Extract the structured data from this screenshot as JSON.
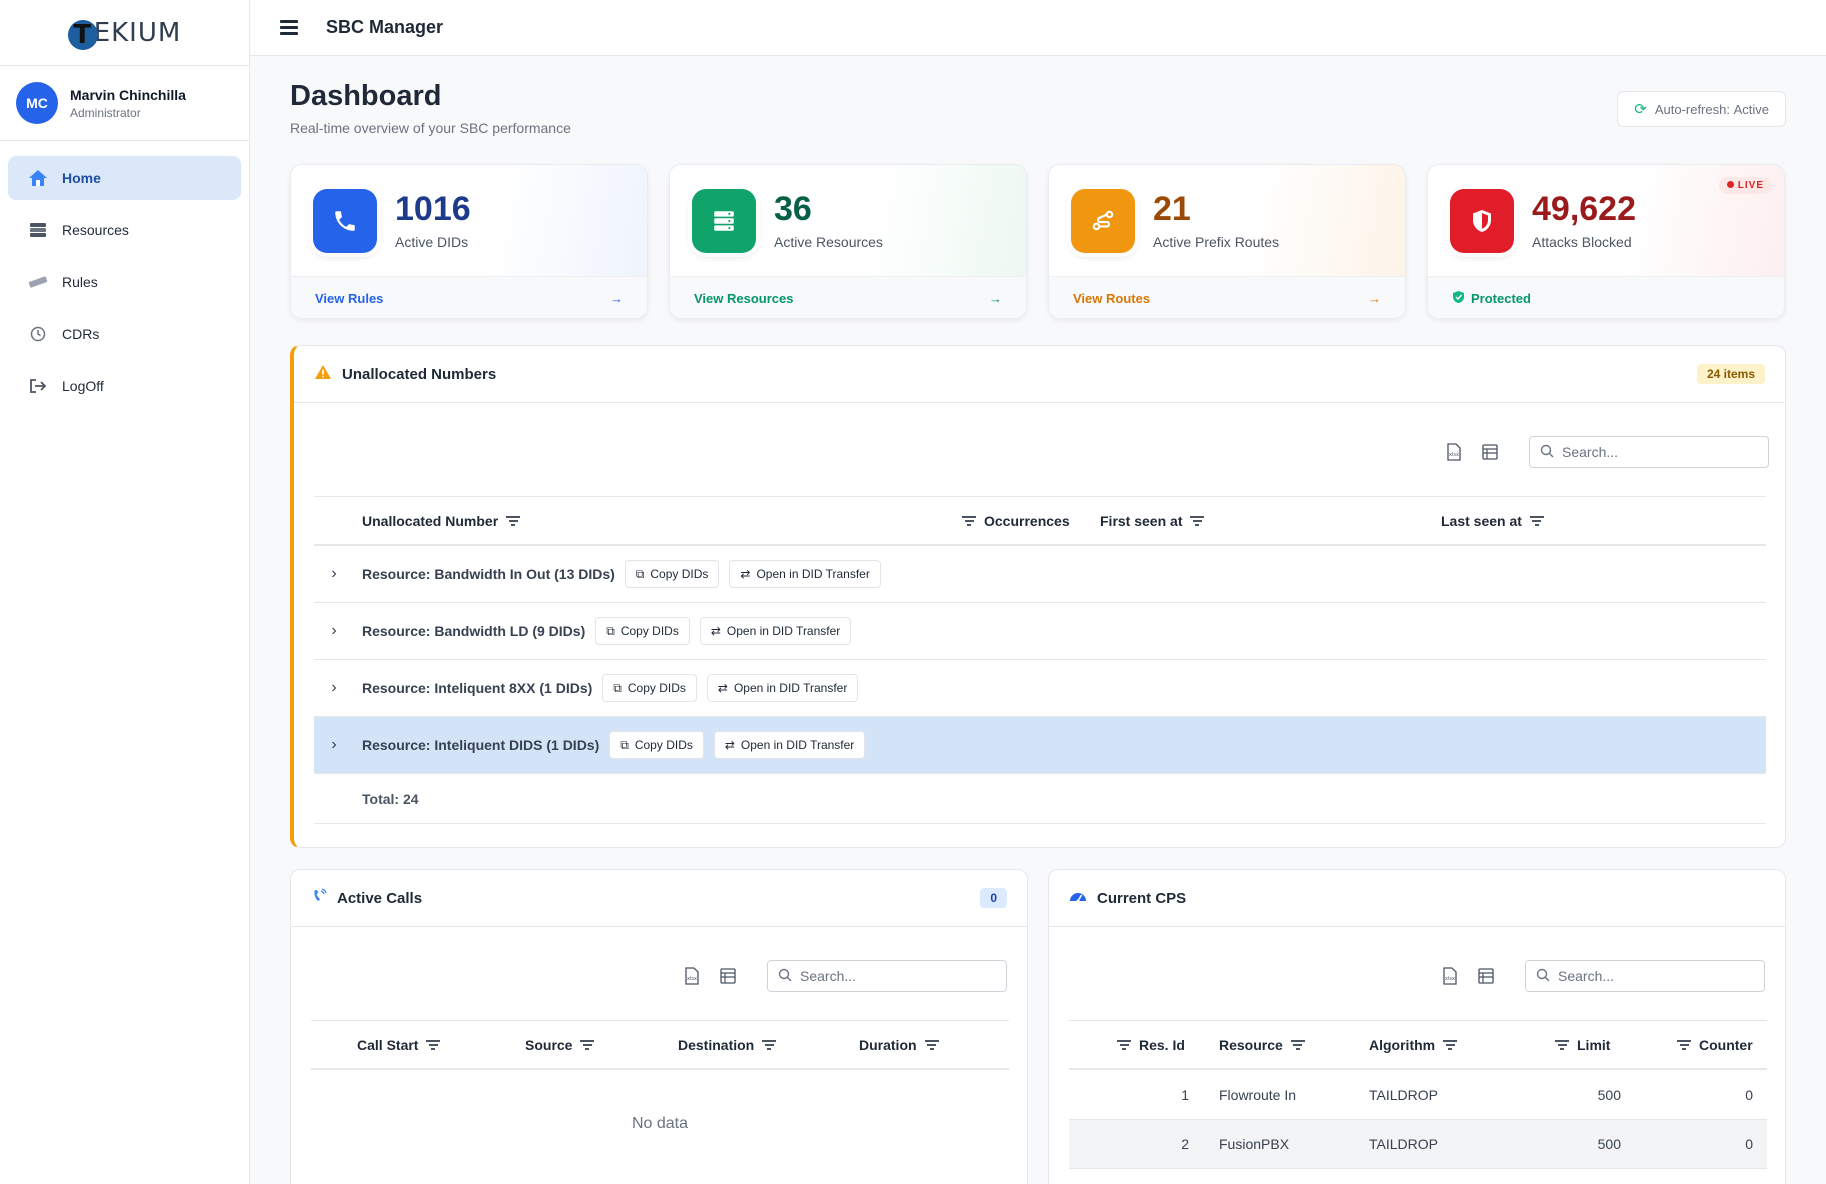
{
  "brand": {
    "logo_text": "EKIUM",
    "logo_initial": "T"
  },
  "user": {
    "initials": "MC",
    "name": "Marvin Chinchilla",
    "role": "Administrator"
  },
  "nav": [
    {
      "label": "Home",
      "icon": "home-icon",
      "active": true
    },
    {
      "label": "Resources",
      "icon": "server-icon",
      "active": false
    },
    {
      "label": "Rules",
      "icon": "ruler-icon",
      "active": false
    },
    {
      "label": "CDRs",
      "icon": "history-icon",
      "active": false
    },
    {
      "label": "LogOff",
      "icon": "logout-icon",
      "active": false
    }
  ],
  "topbar": {
    "title": "SBC Manager"
  },
  "page": {
    "title": "Dashboard",
    "subtitle": "Real-time overview of your SBC performance",
    "autorefresh_label": "Auto-refresh:",
    "autorefresh_value": "Active"
  },
  "stats": [
    {
      "value": "1016",
      "label": "Active DIDs",
      "link": "View Rules",
      "color": "#2563eb",
      "icon": "phone-icon"
    },
    {
      "value": "36",
      "label": "Active Resources",
      "link": "View Resources",
      "color": "#10a36b",
      "icon": "server-icon"
    },
    {
      "value": "21",
      "label": "Active Prefix Routes",
      "link": "View Routes",
      "color": "#e8900c",
      "icon": "route-icon"
    },
    {
      "value": "49,622",
      "label": "Attacks Blocked",
      "link": "Protected",
      "color": "#dc2626",
      "icon": "shield-icon",
      "badge": "LIVE"
    }
  ],
  "unallocated": {
    "title": "Unallocated Numbers",
    "badge": "24 items",
    "search_placeholder": "Search...",
    "columns": [
      "Unallocated Number",
      "Occurrences",
      "First seen at",
      "Last seen at"
    ],
    "groups": [
      {
        "label": "Resource: Bandwidth In Out (13 DIDs)",
        "selected": false
      },
      {
        "label": "Resource: Bandwidth LD (9 DIDs)",
        "selected": false
      },
      {
        "label": "Resource: Inteliquent 8XX (1 DIDs)",
        "selected": false
      },
      {
        "label": "Resource: Inteliquent DIDS (1 DIDs)",
        "selected": true
      }
    ],
    "copy_label": "Copy DIDs",
    "transfer_label": "Open in DID Transfer",
    "total": "Total: 24"
  },
  "active_calls": {
    "title": "Active Calls",
    "badge": "0",
    "search_placeholder": "Search...",
    "columns": [
      "Call Start",
      "Source",
      "Destination",
      "Duration"
    ],
    "empty": "No data"
  },
  "cps": {
    "title": "Current CPS",
    "search_placeholder": "Search...",
    "columns": [
      "Res. Id",
      "Resource",
      "Algorithm",
      "Limit",
      "Counter"
    ],
    "rows": [
      {
        "id": "1",
        "resource": "Flowroute In",
        "algorithm": "TAILDROP",
        "limit": "500",
        "counter": "0"
      },
      {
        "id": "2",
        "resource": "FusionPBX",
        "algorithm": "TAILDROP",
        "limit": "500",
        "counter": "0"
      }
    ]
  }
}
